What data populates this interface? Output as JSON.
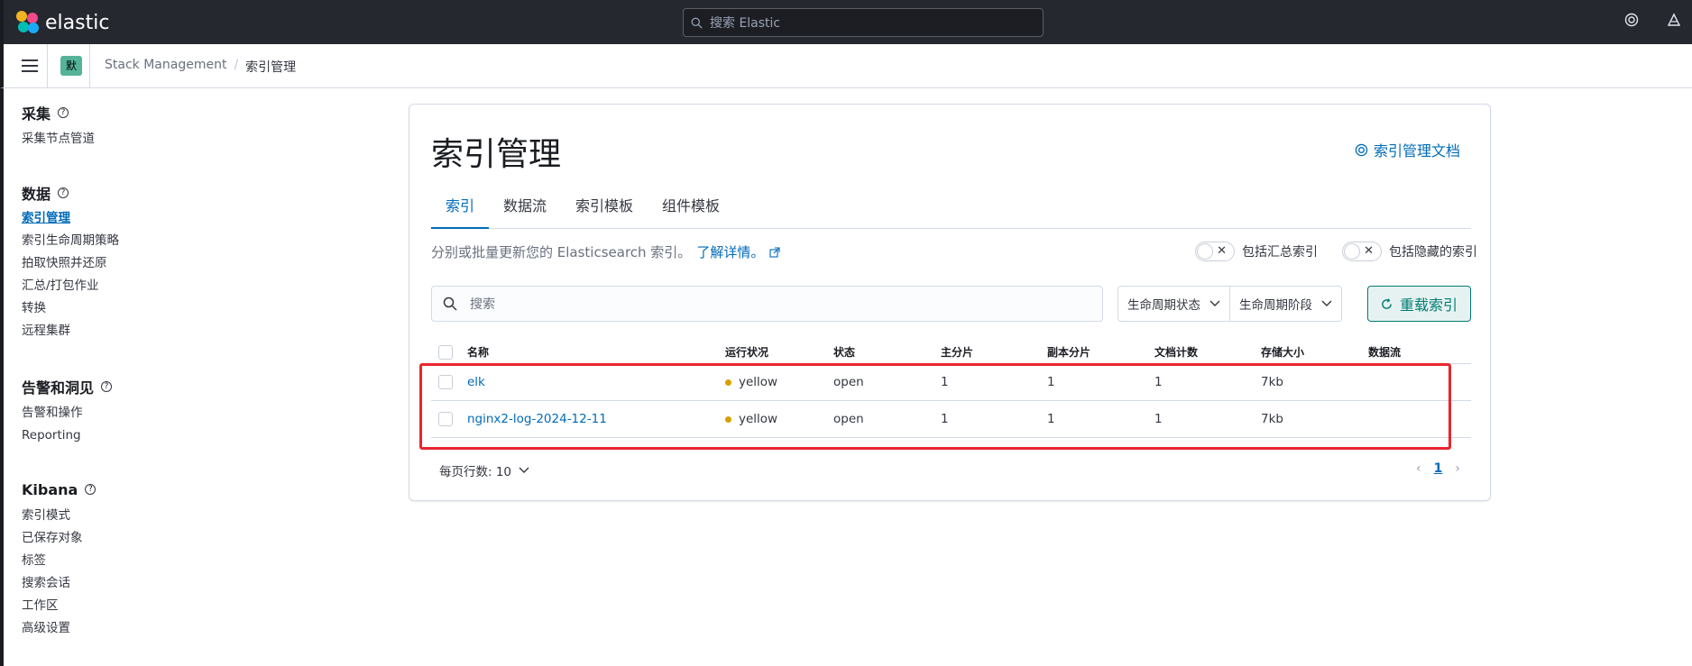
{
  "header": {
    "brand": "elastic",
    "search_placeholder": "搜索 Elastic",
    "icons": [
      "help-ring-icon",
      "newsfeed-icon"
    ]
  },
  "breadcrumb": {
    "space_initial": "默",
    "items": [
      "Stack Management",
      "/",
      "索引管理"
    ]
  },
  "sidebar": {
    "sections": [
      {
        "title": "采集",
        "items": [
          "采集节点管道"
        ]
      },
      {
        "title": "数据",
        "items": [
          "索引管理",
          "索引生命周期策略",
          "拍取快照并还原",
          "汇总/打包作业",
          "转换",
          "远程集群"
        ]
      },
      {
        "title": "告警和洞见",
        "items": [
          "告警和操作",
          "Reporting"
        ]
      },
      {
        "title": "Kibana",
        "items": [
          "索引模式",
          "已保存对象",
          "标签",
          "搜索会话",
          "工作区",
          "高级设置"
        ]
      }
    ],
    "active_item": "索引管理"
  },
  "main": {
    "title": "索引管理",
    "doc_link": "索引管理文档",
    "tabs": [
      "索引",
      "数据流",
      "索引模板",
      "组件模板"
    ],
    "active_tab": "索引",
    "description": "分别或批量更新您的 Elasticsearch 索引。",
    "learn_more": "了解详情。",
    "toggle_rollup": "包括汇总索引",
    "toggle_hidden": "包括隐藏的索引",
    "search_placeholder": "搜索",
    "filter_lifecycle_status": "生命周期状态",
    "filter_lifecycle_phase": "生命周期阶段",
    "reload_button": "重载索引",
    "columns": [
      "名称",
      "运行状况",
      "状态",
      "主分片",
      "副本分片",
      "文档计数",
      "存储大小",
      "数据流"
    ],
    "rows": [
      {
        "name": "elk",
        "health": "yellow",
        "status": "open",
        "primary": "1",
        "replica": "1",
        "docs": "1",
        "size": "7kb",
        "stream": ""
      },
      {
        "name": "nginx2-log-2024-12-11",
        "health": "yellow",
        "status": "open",
        "primary": "1",
        "replica": "1",
        "docs": "1",
        "size": "7kb",
        "stream": ""
      }
    ],
    "rows_per_page": "每页行数: 10",
    "current_page": "1"
  },
  "colors": {
    "accent": "#006bb8",
    "health_yellow": "#d6a100",
    "reload": "#017d73",
    "highlight": "#e8262e"
  }
}
